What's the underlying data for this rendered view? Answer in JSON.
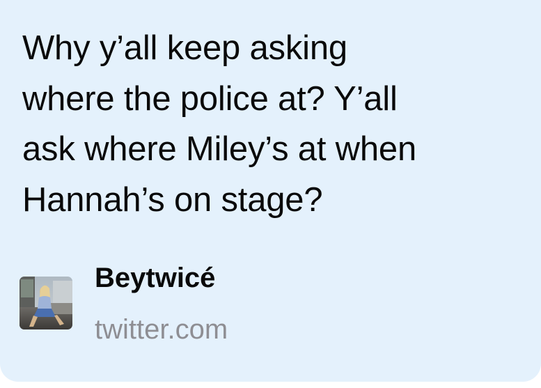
{
  "post": {
    "lines": [
      "Why y’all keep asking",
      "where the police at? Y’all",
      "ask where Miley’s at when",
      "Hannah’s on stage?"
    ]
  },
  "link_preview": {
    "title": "Beytwicé",
    "domain": "twitter.com",
    "thumbnail": "photo-thumbnail"
  },
  "colors": {
    "card_background": "#e4f1fc",
    "text": "#0a0a0a",
    "domain_text": "#8e8e93"
  }
}
